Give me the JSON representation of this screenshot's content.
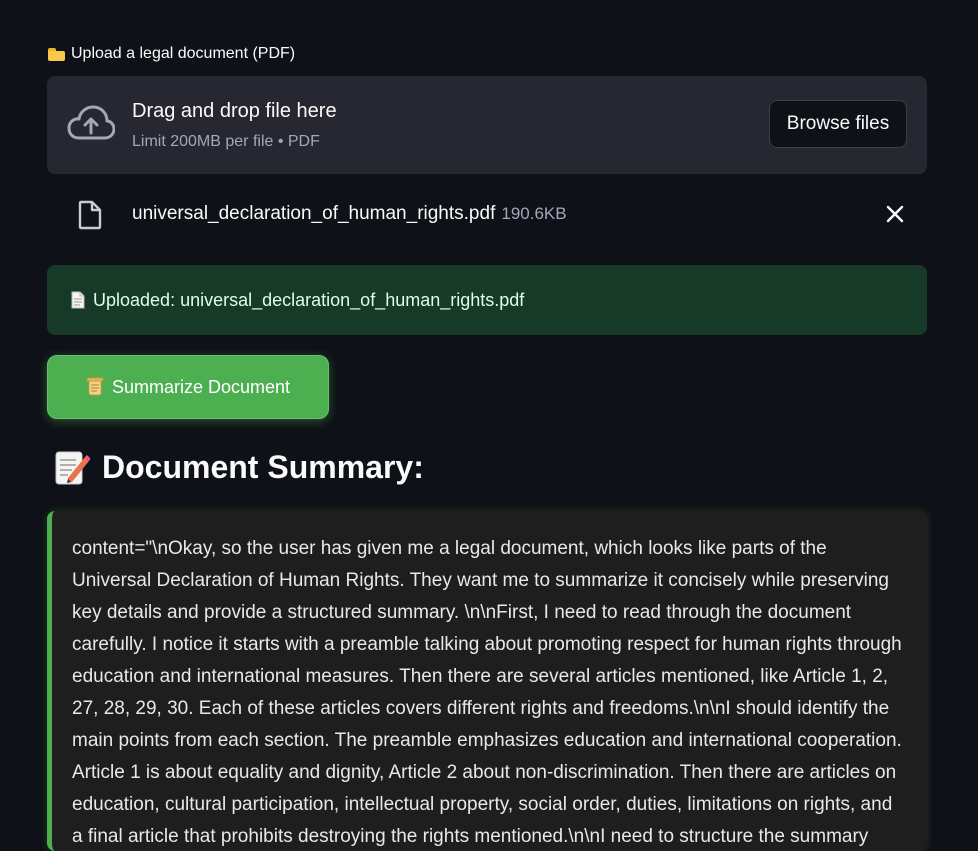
{
  "uploader": {
    "label": "Upload a legal document (PDF)",
    "label_icon": "folder-icon",
    "dropzone_title": "Drag and drop file here",
    "dropzone_limit": "Limit 200MB per file • PDF",
    "browse_label": "Browse files"
  },
  "file": {
    "name": "universal_declaration_of_human_rights.pdf",
    "size": "190.6KB"
  },
  "success": {
    "message": "Uploaded: universal_declaration_of_human_rights.pdf",
    "color": "#173928"
  },
  "summarize": {
    "label": "Summarize Document",
    "color": "#4caf50"
  },
  "summary": {
    "heading": "Document Summary:",
    "text": "content=\"\\nOkay, so the user has given me a legal document, which looks like parts of the Universal Declaration of Human Rights. They want me to summarize it concisely while preserving key details and provide a structured summary. \\n\\nFirst, I need to read through the document carefully. I notice it starts with a preamble talking about promoting respect for human rights through education and international measures. Then there are several articles mentioned, like Article 1, 2, 27, 28, 29, 30. Each of these articles covers different rights and freedoms.\\n\\nI should identify the main points from each section. The preamble emphasizes education and international cooperation. Article 1 is about equality and dignity, Article 2 about non-discrimination. Then there are articles on education, cultural participation, intellectual property, social order, duties, limitations on rights, and a final article that prohibits destroying the rights mentioned.\\n\\nI need to structure the summary with"
  },
  "theme": {
    "background": "#0e1117",
    "accent": "#4caf50"
  }
}
